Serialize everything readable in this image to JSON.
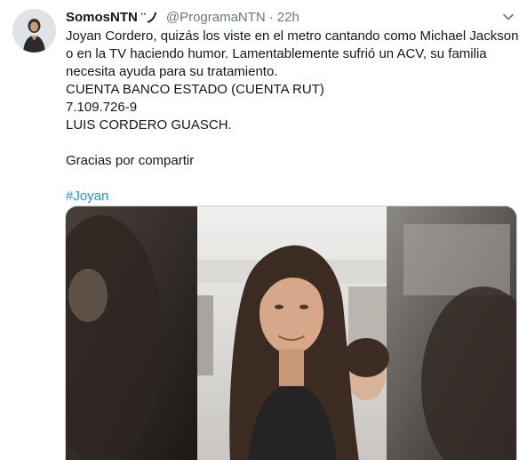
{
  "tweet": {
    "display_name": "SomosNTN",
    "name_emoji": "¨ノ",
    "handle": "@ProgramaNTN",
    "separator": "·",
    "time": "22h",
    "lines": [
      "Joyan Cordero, quizás los viste en el metro cantando como Michael Jackson",
      "o en la TV haciendo humor. Lamentablemente sufrió un ACV, su familia",
      "necesita ayuda para su tratamiento.",
      "CUENTA BANCO ESTADO (CUENTA RUT)",
      "7.109.726-9",
      "LUIS CORDERO GUASCH.",
      "Gracias por compartir",
      "#Joyan"
    ]
  },
  "icons": {
    "caret": "chevron-down-icon",
    "avatar": "avatar-image",
    "media": "video-thumbnail"
  },
  "colors": {
    "link": "#1b95e0",
    "secondary_text": "#657786",
    "primary_text": "#14171a",
    "border": "#ccd6dd"
  }
}
